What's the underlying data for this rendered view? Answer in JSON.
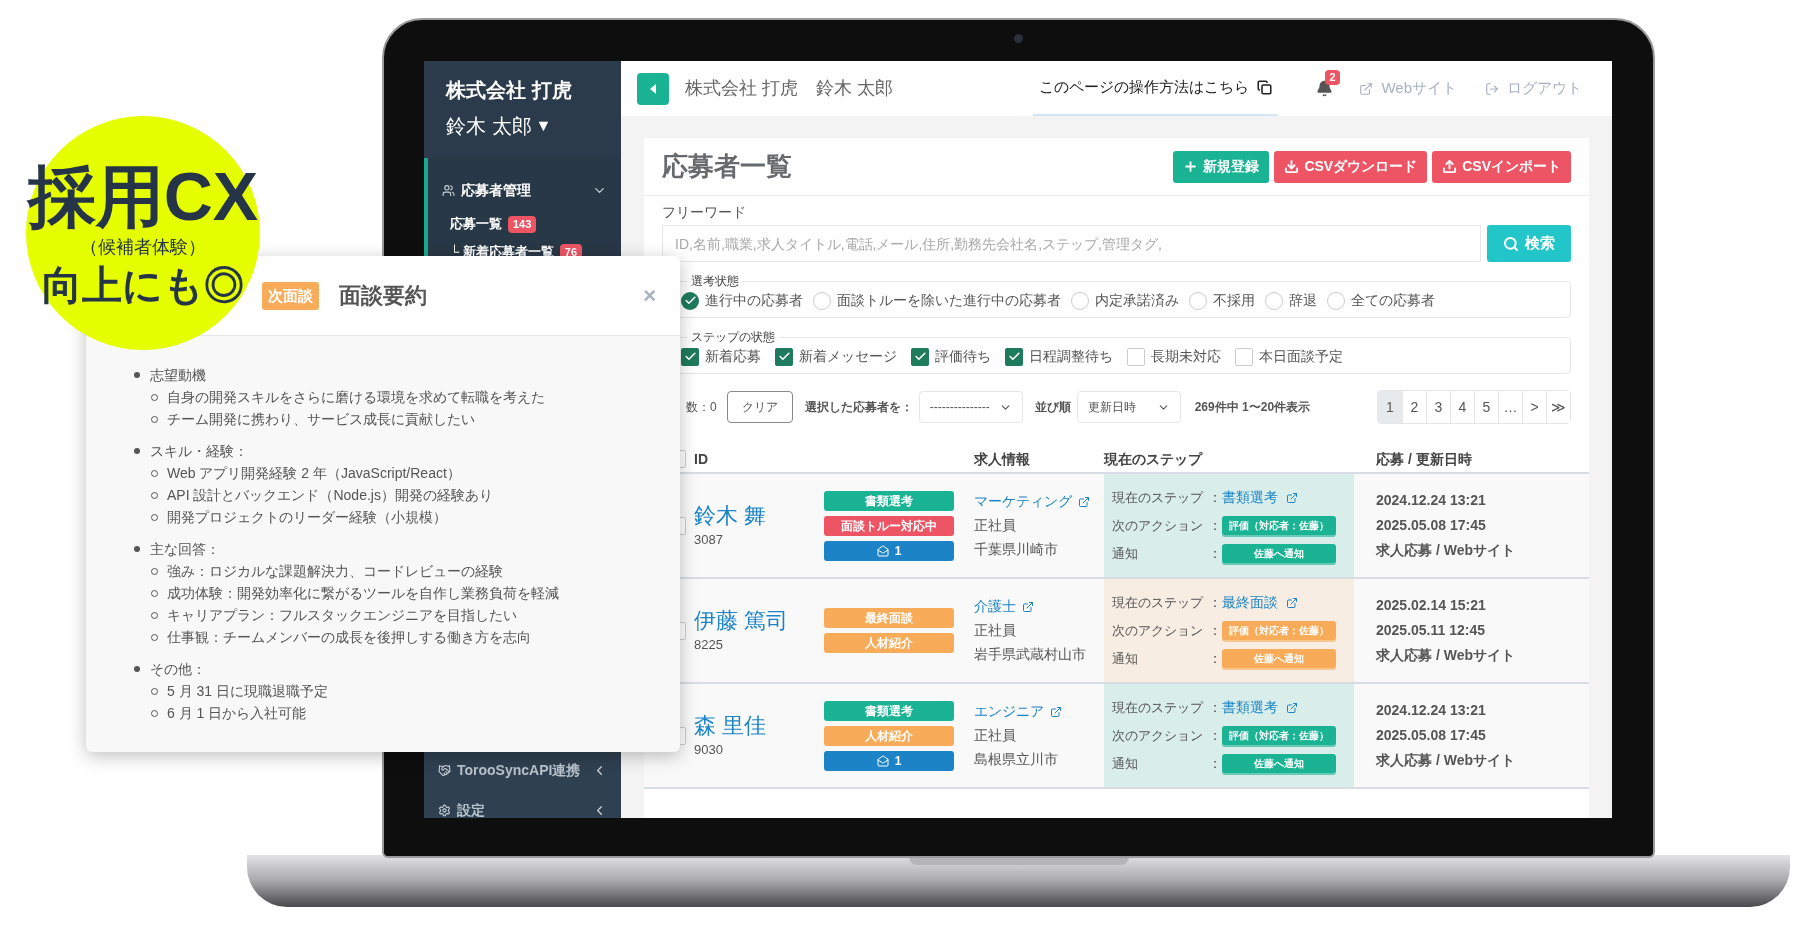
{
  "promo": {
    "title": "採用CX",
    "subtitle": "（候補者体験）",
    "tagline": "向上にも◎"
  },
  "sidebar": {
    "company": "株式会社 打虎",
    "user": "鈴木 太郎",
    "user_caret": "▼",
    "items": [
      {
        "label": "応募者管理",
        "expanded": true,
        "children": [
          {
            "label": "応募一覧",
            "count": "143"
          },
          {
            "label": "└ 新着応募者一覧",
            "count": "76"
          }
        ]
      },
      {
        "label": "TorooSyncAPI連携",
        "expanded": false
      },
      {
        "label": "設定",
        "expanded": false
      }
    ]
  },
  "header": {
    "company": "株式会社 打虎",
    "user": "鈴木 太郎",
    "help_link": "このページの操作方法はこちら",
    "notifications": "2",
    "website": "Webサイト",
    "logout": "ログアウト"
  },
  "page": {
    "title": "応募者一覧",
    "buttons": [
      {
        "label": "新規登録",
        "kind": "create"
      },
      {
        "label": "CSVダウンロード",
        "kind": "download"
      },
      {
        "label": "CSVインポート",
        "kind": "import"
      }
    ]
  },
  "search": {
    "label": "フリーワード",
    "placeholder": "ID,名前,職業,求人タイトル,電話,メール,住所,勤務先会社名,ステップ,管理タグ,",
    "button": "検索"
  },
  "selection_status": {
    "legend": "選考状態",
    "options": [
      {
        "label": "進行中の応募者",
        "selected": true
      },
      {
        "label": "面談トルーを除いた進行中の応募者",
        "selected": false
      },
      {
        "label": "内定承諾済み",
        "selected": false
      },
      {
        "label": "不採用",
        "selected": false
      },
      {
        "label": "辞退",
        "selected": false
      },
      {
        "label": "全ての応募者",
        "selected": false
      }
    ]
  },
  "step_status": {
    "legend": "ステップの状態",
    "options": [
      {
        "label": "新着応募",
        "checked": true
      },
      {
        "label": "新着メッセージ",
        "checked": true
      },
      {
        "label": "評価待ち",
        "checked": true
      },
      {
        "label": "日程調整待ち",
        "checked": true
      },
      {
        "label": "長期未対応",
        "checked": false
      },
      {
        "label": "本日面談予定",
        "checked": false
      }
    ]
  },
  "toolbar": {
    "selected_count": "数：0",
    "clear": "クリア",
    "bulk_label": "選択した応募者を：",
    "bulk_value": "---------------",
    "sort_label": "並び順",
    "sort_value": "更新日時",
    "summary": "269件中 1〜20件表示",
    "pages": [
      {
        "label": "1",
        "selected": true
      },
      {
        "label": "2",
        "selected": false
      },
      {
        "label": "3",
        "selected": false
      },
      {
        "label": "4",
        "selected": false
      },
      {
        "label": "5",
        "selected": false
      },
      {
        "label": "…",
        "selected": false
      },
      {
        "label": ">",
        "selected": false
      },
      {
        "label": "≫",
        "selected": false
      }
    ]
  },
  "table": {
    "select_all": {
      "checked": false
    },
    "columns": [
      "ID",
      "求人情報",
      "現在のステップ",
      "応募 / 更新日時"
    ],
    "rows": [
      {
        "checked": false,
        "name": "鈴木 舞",
        "id": "3087",
        "tags": [
          {
            "kind": "label",
            "label": "書類選考",
            "color": "#1ab394"
          },
          {
            "kind": "label",
            "label": "面談トルー対応中",
            "color": "#ed5565"
          },
          {
            "kind": "mail",
            "label": "1",
            "color": "#1c84c6"
          }
        ],
        "job": {
          "title": "マーケティング",
          "type": "正社員",
          "location": "千葉県川崎市"
        },
        "step": {
          "color": "#1ab394",
          "fields": [
            {
              "kind": "link",
              "label": "現在のステップ",
              "colon": "：",
              "value": "書類選考"
            },
            {
              "kind": "button",
              "label": "次のアクション",
              "colon": "：",
              "value": "評価（対応者：佐藤）"
            },
            {
              "kind": "button",
              "label": "通知",
              "colon": "：",
              "value": "佐藤へ通知"
            }
          ]
        },
        "dates": [
          "2024.12.24 13:21",
          "2025.05.08 17:45",
          "求人応募 / Webサイト"
        ]
      },
      {
        "checked": false,
        "name": "伊藤 篤司",
        "id": "8225",
        "tags": [
          {
            "kind": "label",
            "label": "最終面談",
            "color": "#f8ac59"
          },
          {
            "kind": "label",
            "label": "人材紹介",
            "color": "#f8ac59"
          }
        ],
        "job": {
          "title": "介護士",
          "type": "正社員",
          "location": "岩手県武蔵村山市"
        },
        "step": {
          "color": "#f8ac59",
          "fields": [
            {
              "kind": "link",
              "label": "現在のステップ",
              "colon": "：",
              "value": "最終面談"
            },
            {
              "kind": "button",
              "label": "次のアクション",
              "colon": "：",
              "value": "評価（対応者：佐藤）"
            },
            {
              "kind": "button",
              "label": "通知",
              "colon": "：",
              "value": "佐藤へ通知"
            }
          ]
        },
        "dates": [
          "2025.02.14 15:21",
          "2025.05.11 12:45",
          "求人応募 / Webサイト"
        ]
      },
      {
        "checked": false,
        "name": "森 里佳",
        "id": "9030",
        "tags": [
          {
            "kind": "label",
            "label": "書類選考",
            "color": "#1ab394"
          },
          {
            "kind": "label",
            "label": "人材紹介",
            "color": "#f8ac59"
          },
          {
            "kind": "mail",
            "label": "1",
            "color": "#1c84c6"
          }
        ],
        "job": {
          "title": "エンジニア",
          "type": "正社員",
          "location": "島根県立川市"
        },
        "step": {
          "color": "#1ab394",
          "fields": [
            {
              "kind": "link",
              "label": "現在のステップ",
              "colon": "：",
              "value": "書類選考"
            },
            {
              "kind": "button",
              "label": "次のアクション",
              "colon": "：",
              "value": "評価（対応者：佐藤）"
            },
            {
              "kind": "button",
              "label": "通知",
              "colon": "：",
              "value": "佐藤へ通知"
            }
          ]
        },
        "dates": [
          "2024.12.24 13:21",
          "2025.05.08 17:45",
          "求人応募 / Webサイト"
        ]
      }
    ]
  },
  "modal": {
    "tag": "次面談",
    "title": "面談要約",
    "close": "×",
    "sections": [
      {
        "heading": "志望動機",
        "items": [
          "自身の開発スキルをさらに磨ける環境を求めて転職を考えた",
          "チーム開発に携わり、サービス成長に貢献したい"
        ]
      },
      {
        "heading": "スキル・経験：",
        "items": [
          "Web アプリ開発経験 2 年（JavaScript/React）",
          "API 設計とバックエンド（Node.js）開発の経験あり",
          "開発プロジェクトのリーダー経験（小規模）"
        ]
      },
      {
        "heading": "主な回答：",
        "items": [
          "強み：ロジカルな課題解決力、コードレビューの経験",
          "成功体験：開発効率化に繋がるツールを自作し業務負荷を軽減",
          "キャリアプラン：フルスタックエンジニアを目指したい",
          "仕事観：チームメンバーの成長を後押しする働き方を志向"
        ]
      },
      {
        "heading": "その他：",
        "items": [
          "5 月 31 日に現職退職予定",
          "6 月 1 日から入社可能"
        ]
      }
    ]
  }
}
